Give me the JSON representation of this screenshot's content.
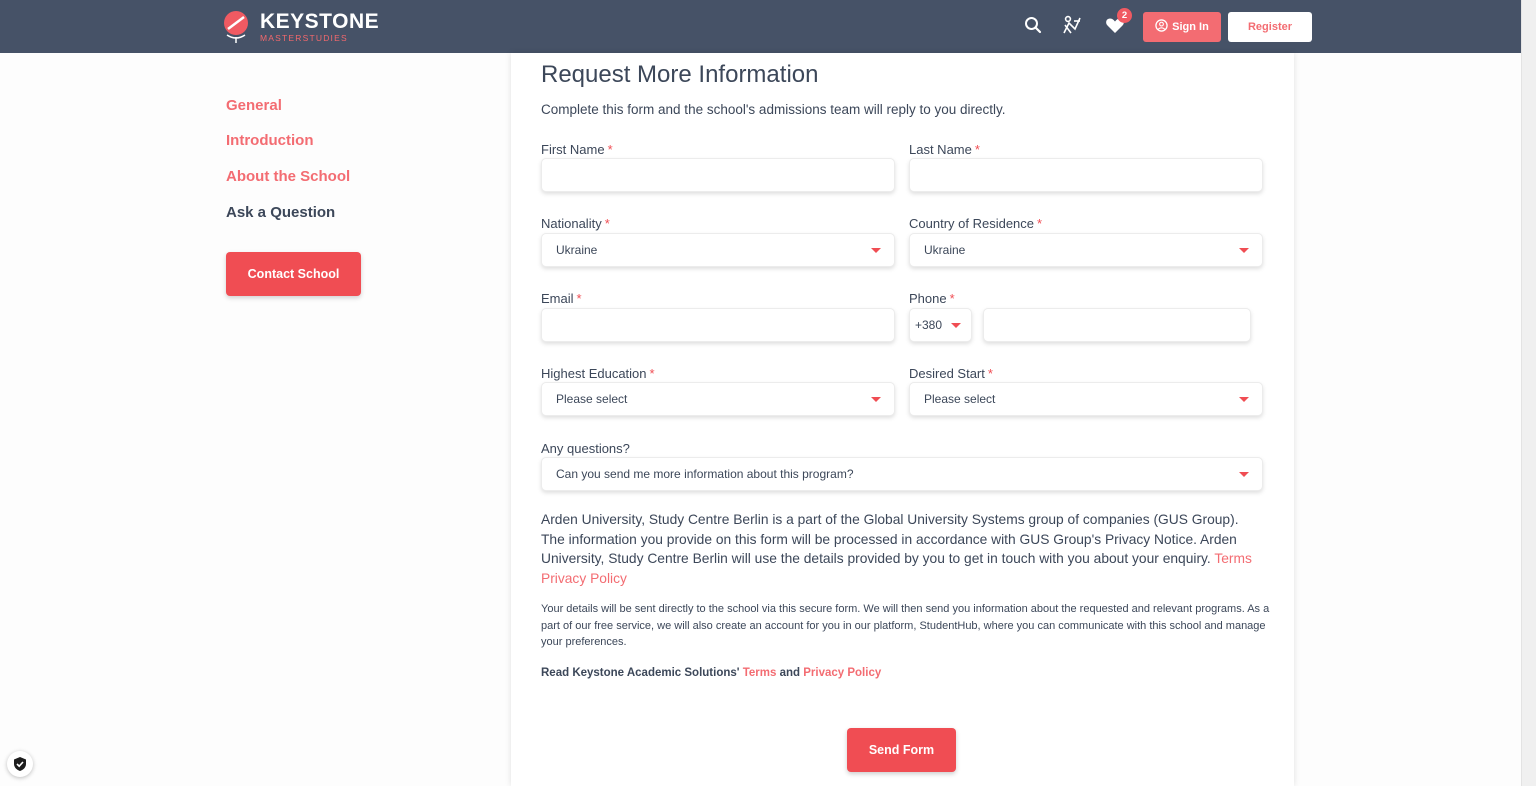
{
  "header": {
    "logo_title": "KEYSTONE",
    "logo_subtitle": "MASTERSTUDIES",
    "wishlist_count": "2",
    "sign_in_label": "Sign In",
    "register_label": "Register",
    "icons": [
      "search-icon",
      "compare-icon",
      "heart-icon",
      "user-circle-icon"
    ]
  },
  "sidebar": {
    "items": [
      {
        "label": "General",
        "active": false
      },
      {
        "label": "Introduction",
        "active": false
      },
      {
        "label": "About the School",
        "active": false
      },
      {
        "label": "Ask a Question",
        "active": true
      }
    ],
    "contact_label": "Contact School"
  },
  "form": {
    "title": "Request More Information",
    "subtitle": "Complete this form and the school's admissions team will reply to you directly.",
    "first_name": {
      "label": "First Name",
      "value": ""
    },
    "last_name": {
      "label": "Last Name",
      "value": ""
    },
    "nationality": {
      "label": "Nationality",
      "value": "Ukraine"
    },
    "residence": {
      "label": "Country of Residence",
      "value": "Ukraine"
    },
    "email": {
      "label": "Email",
      "value": ""
    },
    "phone": {
      "label": "Phone",
      "code": "+380",
      "value": ""
    },
    "education": {
      "label": "Highest Education",
      "value": "Please select"
    },
    "start": {
      "label": "Desired Start",
      "value": "Please select"
    },
    "questions": {
      "label": "Any questions?",
      "value": "Can you send me more information about this program?"
    },
    "required_mark": "*",
    "disclaimer_text": "Arden University, Study Centre Berlin is a part of the Global University Systems group of companies (GUS Group). The information you provide on this form will be processed in accordance with GUS Group's Privacy Notice. Arden University, Study Centre Berlin will use the details provided by you to get in touch with you about your enquiry.",
    "disclaimer_terms": "Terms",
    "disclaimer_privacy": "Privacy Policy",
    "note": "Your details will be sent directly to the school via this secure form. We will then send you information about the requested and relevant programs. As a part of our free service, we will also create an account for you in our platform, StudentHub, where you can communicate with this school and manage your preferences.",
    "read_prefix": "Read Keystone Academic Solutions'",
    "read_terms": "Terms",
    "read_and": "and",
    "read_privacy": "Privacy Policy",
    "send_label": "Send Form"
  },
  "colors": {
    "header_bg": "#465267",
    "accent": "#f04d53",
    "link": "#f36c72",
    "text": "#3c4759"
  }
}
